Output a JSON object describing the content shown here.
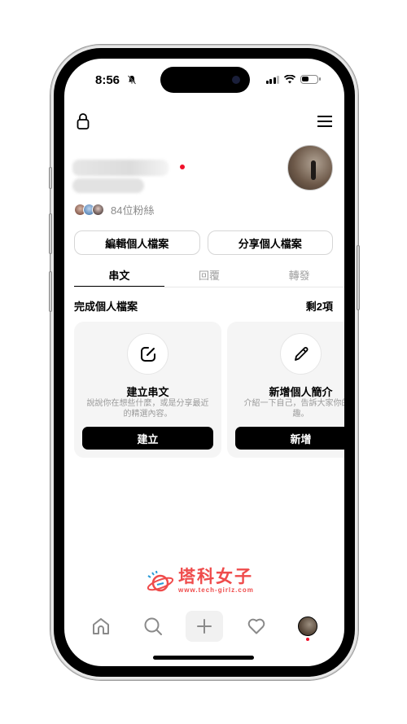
{
  "status_bar": {
    "time": "8:56",
    "silent_icon": "bell-slash-icon",
    "signal_icon": "cellular-signal-icon",
    "wifi_icon": "wifi-icon",
    "battery_icon": "battery-icon"
  },
  "header": {
    "left_icon": "lock-icon",
    "right_icon": "hamburger-menu-icon"
  },
  "profile": {
    "name": "",
    "followers_text": "84位粉絲",
    "notification_color": "#f0102a"
  },
  "actions": {
    "edit_profile": "編輯個人檔案",
    "share_profile": "分享個人檔案"
  },
  "tabs": [
    {
      "label": "串文",
      "active": true
    },
    {
      "label": "回覆",
      "active": false
    },
    {
      "label": "轉發",
      "active": false
    }
  ],
  "complete_profile": {
    "title": "完成個人檔案",
    "remaining": "剩2項",
    "cards": [
      {
        "icon": "compose-icon",
        "title": "建立串文",
        "description": "說說你在想些什麼，或是分享最近的精選內容。",
        "button": "建立"
      },
      {
        "icon": "pencil-icon",
        "title": "新增個人簡介",
        "description": "介紹一下自己，告訴大家你的興趣。",
        "button": "新增"
      }
    ]
  },
  "watermark": {
    "title": "塔科女子",
    "url": "www.tech-girlz.com",
    "color": "#ef4b4b"
  },
  "bottom_nav": [
    {
      "icon": "home-icon"
    },
    {
      "icon": "search-icon"
    },
    {
      "icon": "plus-icon"
    },
    {
      "icon": "heart-icon"
    },
    {
      "icon": "profile-avatar"
    }
  ]
}
